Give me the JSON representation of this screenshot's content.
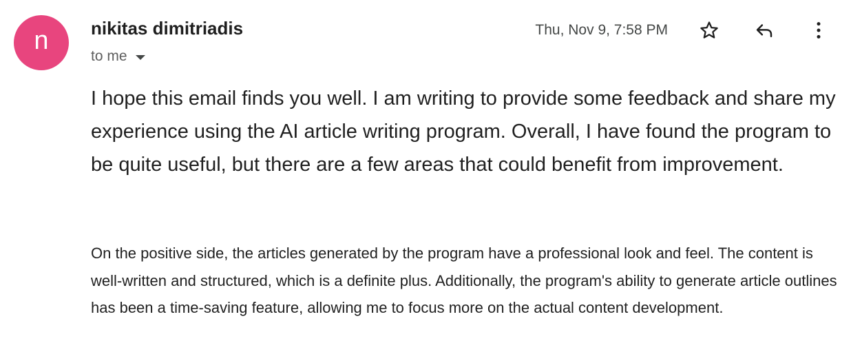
{
  "sender": {
    "avatar_letter": "n",
    "avatar_color": "#e8457e",
    "name": "nikitas dimitriadis",
    "recipient_label": "to me"
  },
  "header": {
    "timestamp": "Thu, Nov 9, 7:58 PM",
    "actions": [
      {
        "icon": "star-icon"
      },
      {
        "icon": "reply-icon"
      },
      {
        "icon": "more-vert-icon"
      }
    ]
  },
  "message": {
    "paragraphs": [
      "I hope this email finds you well. I am writing to provide some feedback and share my experience using the AI article writing program. Overall, I have found the program to be quite useful, but there are a few areas that could benefit from improvement.",
      "On the positive side, the articles generated by the program have a professional look and feel. The content is well-written and structured, which is a definite plus. Additionally, the program's ability to generate article outlines has been a time-saving feature, allowing me to focus more on the actual content development."
    ]
  }
}
